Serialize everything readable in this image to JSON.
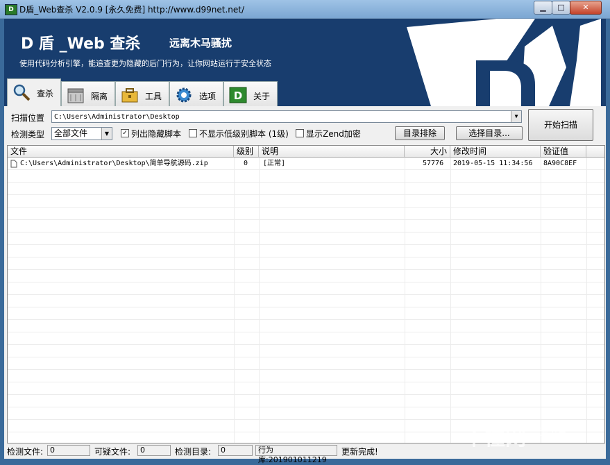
{
  "window": {
    "title": "D盾_Web查杀 V2.0.9 [永久免费] http://www.d99net.net/"
  },
  "banner": {
    "title": "D 盾 _Web 查杀",
    "subtitle": "远离木马骚扰",
    "tagline": "使用代码分析引擎，能追查更为隐藏的后门行为，让你网站运行于安全状态"
  },
  "tabs": [
    {
      "label": "查杀",
      "icon": "magnifier-icon"
    },
    {
      "label": "隔离",
      "icon": "quarantine-box-icon"
    },
    {
      "label": "工具",
      "icon": "toolbox-icon"
    },
    {
      "label": "选项",
      "icon": "gear-icon"
    },
    {
      "label": "关于",
      "icon": "d-logo-icon"
    }
  ],
  "scan": {
    "path_label": "扫描位置",
    "path_value": "C:\\Users\\Administrator\\Desktop",
    "type_label": "检测类型",
    "type_value": "全部文件",
    "list_hidden_label": "列出隐藏脚本",
    "list_hidden_checked": true,
    "hide_low_label": "不显示低级别脚本 (1级)",
    "hide_low_checked": false,
    "zend_label": "显示Zend加密",
    "zend_checked": false,
    "exclude_dirs_button": "目录排除",
    "choose_dir_button": "选择目录...",
    "start_scan_button": "开始扫描"
  },
  "table": {
    "columns": [
      "文件",
      "级别",
      "说明",
      "大小",
      "修改时间",
      "验证值"
    ],
    "rows": [
      {
        "file": "C:\\Users\\Administrator\\Desktop\\简单导航源码.zip",
        "level": "0",
        "desc": "[正常]",
        "size": "57776",
        "mtime": "2019-05-15  11:34:56",
        "hash": "8A90C8EF"
      }
    ]
  },
  "status": {
    "files_label": "检测文件:",
    "files_value": "0",
    "suspicious_label": "可疑文件:",
    "suspicious_value": "0",
    "dirs_label": "检测目录:",
    "dirs_value": "0",
    "lib_text": "行为库:201901011219",
    "update_text": "更新完成!"
  },
  "watermark": {
    "main": "不懂网",
    "sub": "爱分享"
  },
  "colors": {
    "banner_bg": "#183d6e",
    "titlebar": "#7ba6d2"
  }
}
